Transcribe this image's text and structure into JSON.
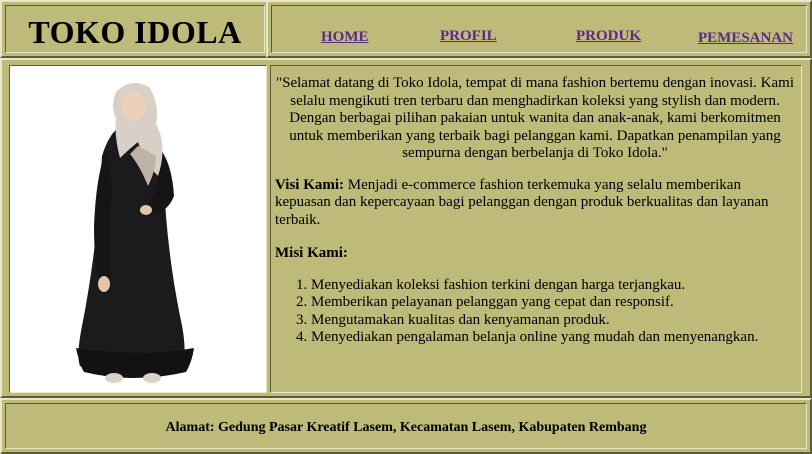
{
  "brand": {
    "title": "TOKO IDOLA"
  },
  "nav": {
    "items": [
      {
        "label": "HOME"
      },
      {
        "label": "PROFIL"
      },
      {
        "label": "PRODUK"
      },
      {
        "label": "PEMESANAN"
      }
    ]
  },
  "main": {
    "image": {
      "icon": "model-dress-photo"
    },
    "welcome": "\"Selamat datang di Toko Idola, tempat di mana fashion bertemu dengan inovasi. Kami selalu mengikuti tren terbaru dan menghadirkan koleksi yang stylish dan modern. Dengan berbagai pilihan pakaian untuk wanita dan anak-anak, kami berkomitmen untuk memberikan yang terbaik bagi pelanggan kami. Dapatkan penampilan yang sempurna dengan berbelanja di Toko Idola.\"",
    "visi": {
      "label": "Visi Kami:",
      "text": " Menjadi e-commerce fashion terkemuka yang selalu memberikan kepuasan dan kepercayaan bagi pelanggan dengan produk berkualitas dan layanan terbaik."
    },
    "misi": {
      "label": "Misi Kami:",
      "items": [
        "Menyediakan koleksi fashion terkini dengan harga terjangkau.",
        "Memberikan pelayanan pelanggan yang cepat dan responsif.",
        "Mengutamakan kualitas dan kenyamanan produk.",
        "Menyediakan pengalaman belanja online yang mudah dan menyenangkan."
      ]
    }
  },
  "footer": {
    "address": "Alamat: Gedung Pasar Kreatif Lasem, Kecamatan Lasem, Kabupaten Rembang"
  },
  "colors": {
    "cell_bg": "#bdba7a",
    "link": "#5b2a86"
  }
}
